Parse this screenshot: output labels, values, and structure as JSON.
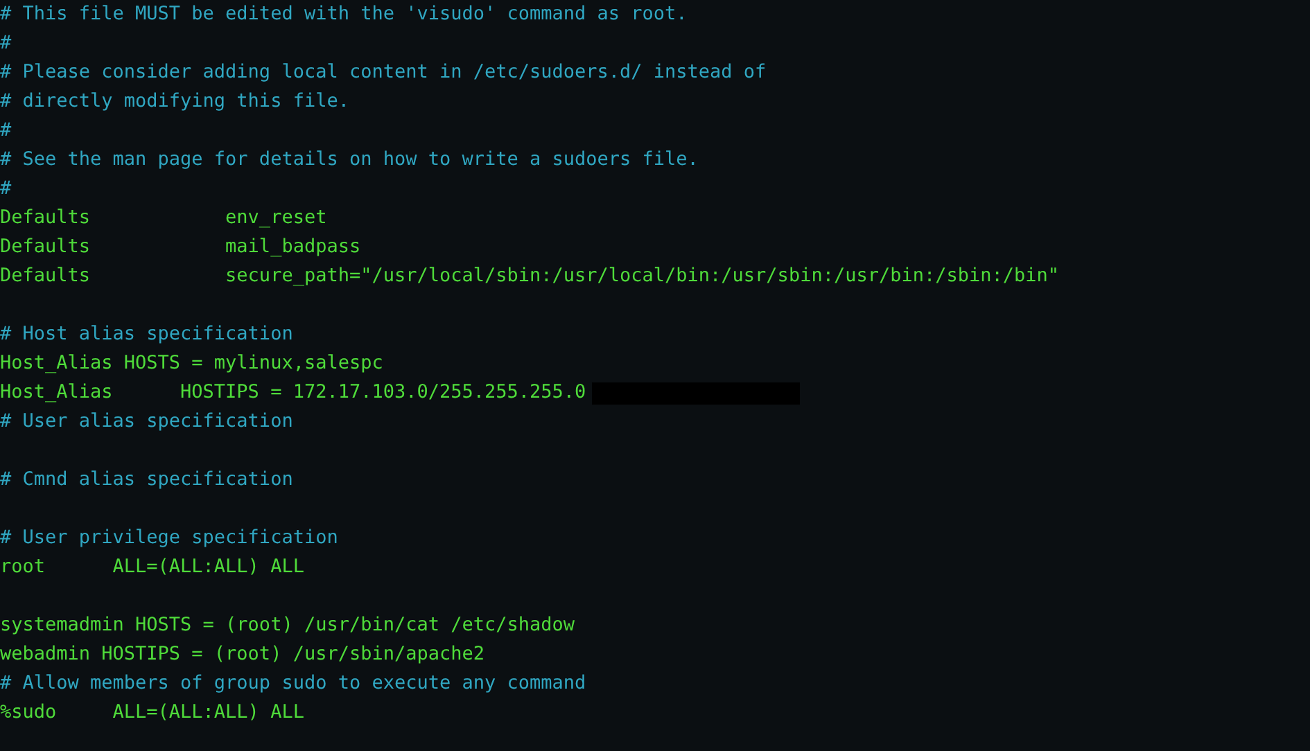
{
  "editor": {
    "lines": [
      {
        "kind": "comment",
        "text": "# This file MUST be edited with the 'visudo' command as root."
      },
      {
        "kind": "comment",
        "text": "#"
      },
      {
        "kind": "comment",
        "text": "# Please consider adding local content in /etc/sudoers.d/ instead of"
      },
      {
        "kind": "comment",
        "text": "# directly modifying this file."
      },
      {
        "kind": "comment",
        "text": "#"
      },
      {
        "kind": "comment",
        "text": "# See the man page for details on how to write a sudoers file."
      },
      {
        "kind": "comment",
        "text": "#"
      },
      {
        "kind": "setting",
        "text": "Defaults            env_reset"
      },
      {
        "kind": "setting",
        "text": "Defaults            mail_badpass"
      },
      {
        "kind": "setting",
        "text": "Defaults            secure_path=\"/usr/local/sbin:/usr/local/bin:/usr/sbin:/usr/bin:/sbin:/bin\""
      },
      {
        "kind": "blank"
      },
      {
        "kind": "comment",
        "text": "# Host alias specification"
      },
      {
        "kind": "setting",
        "text": "Host_Alias HOSTS = mylinux,salespc"
      },
      {
        "kind": "setting",
        "text": "Host_Alias      HOSTIPS = 172.17.103.0/255.255.255.0",
        "redacted": true
      },
      {
        "kind": "comment",
        "text": "# User alias specification"
      },
      {
        "kind": "blank"
      },
      {
        "kind": "comment",
        "text": "# Cmnd alias specification"
      },
      {
        "kind": "blank"
      },
      {
        "kind": "comment",
        "text": "# User privilege specification"
      },
      {
        "kind": "setting",
        "text": "root      ALL=(ALL:ALL) ALL"
      },
      {
        "kind": "blank"
      },
      {
        "kind": "setting",
        "text": "systemadmin HOSTS = (root) /usr/bin/cat /etc/shadow"
      },
      {
        "kind": "setting",
        "text": "webadmin HOSTIPS = (root) /usr/sbin/apache2"
      },
      {
        "kind": "comment",
        "text": "# Allow members of group sudo to execute any command"
      },
      {
        "kind": "setting",
        "text": "%sudo     ALL=(ALL:ALL) ALL"
      }
    ]
  }
}
